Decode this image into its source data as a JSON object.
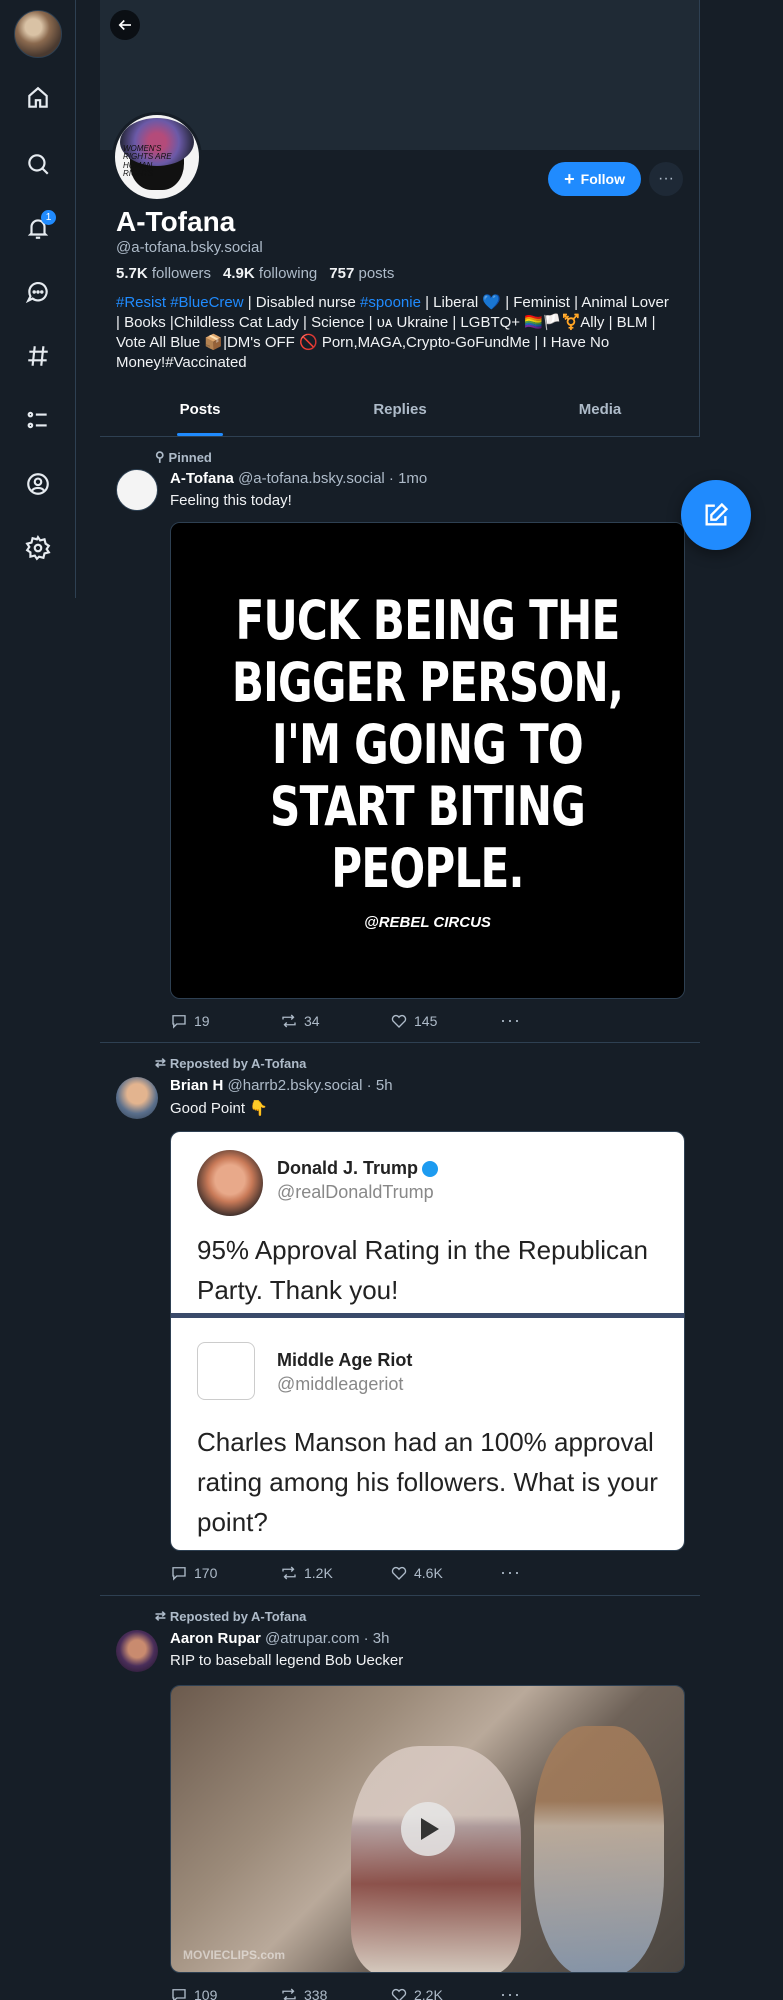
{
  "nav": {
    "notif_count": "1",
    "icons": [
      "home-icon",
      "search-icon",
      "bell-icon",
      "chat-icon",
      "hashtag-icon",
      "list-icon",
      "profile-icon",
      "gear-icon"
    ]
  },
  "profile": {
    "avatar_text": "WOMEN'S RIGHTS ARE HUMAN RIGHTS",
    "display_name": "A-Tofana",
    "handle": "@a-tofana.bsky.social",
    "followers_count": "5.7K",
    "followers_label": "followers",
    "following_count": "4.9K",
    "following_label": "following",
    "posts_count": "757",
    "posts_label": "posts",
    "follow_label": "Follow",
    "more_label": "···",
    "bio": {
      "tag1": "#Resist",
      "tag2": "#BlueCrew",
      "part1": " | Disabled nurse ",
      "tag3": "#spoonie",
      "part2": " | Liberal 💙 | Feminist | Animal Lover | Books |Childless Cat Lady | Science | ᴜᴀ Ukraine | LGBTQ+ 🏳️‍🌈🏳️⚧️Ally | BLM | Vote All Blue 📦|DM's OFF 🚫 Porn,MAGA,Crypto-GoFundMe | I Have No Money!#Vaccinated"
    }
  },
  "tabs": [
    "Posts",
    "Replies",
    "Media"
  ],
  "posts": [
    {
      "context": "Pinned",
      "name": "A-Tofana",
      "meta": "@a-tofana.bsky.social · 1mo",
      "text": "Feeling this today!",
      "image_text": "FUCK BEING THE BIGGER PERSON, I'M GOING TO START BITING PEOPLE.",
      "image_credit": "@REBEL CIRCUS",
      "replies": "19",
      "reposts": "34",
      "likes": "145"
    },
    {
      "context": "Reposted by A-Tofana",
      "name": "Brian H",
      "meta": "@harrb2.bsky.social · 5h",
      "text": "Good Point 👇",
      "tweet1_name": "Donald J. Trump",
      "tweet1_handle": "@realDonaldTrump",
      "tweet1_text": "95% Approval Rating in the Republican Party. Thank you!",
      "tweet2_name": "Middle Age Riot",
      "tweet2_handle": "@middleageriot",
      "tweet2_text": "Charles Manson had an 100% approval rating among his followers. What is your point?",
      "replies": "170",
      "reposts": "1.2K",
      "likes": "4.6K"
    },
    {
      "context": "Reposted by A-Tofana",
      "name": "Aaron Rupar",
      "meta": "@atrupar.com · 3h",
      "text": "RIP to baseball legend Bob Uecker",
      "watermark": "MOVIECLIPS.com",
      "replies": "109",
      "reposts": "338",
      "likes": "2.2K"
    }
  ],
  "more_dots": "···",
  "colors": {
    "accent": "#208bfe",
    "background": "#161e27",
    "border": "#2e4052"
  }
}
